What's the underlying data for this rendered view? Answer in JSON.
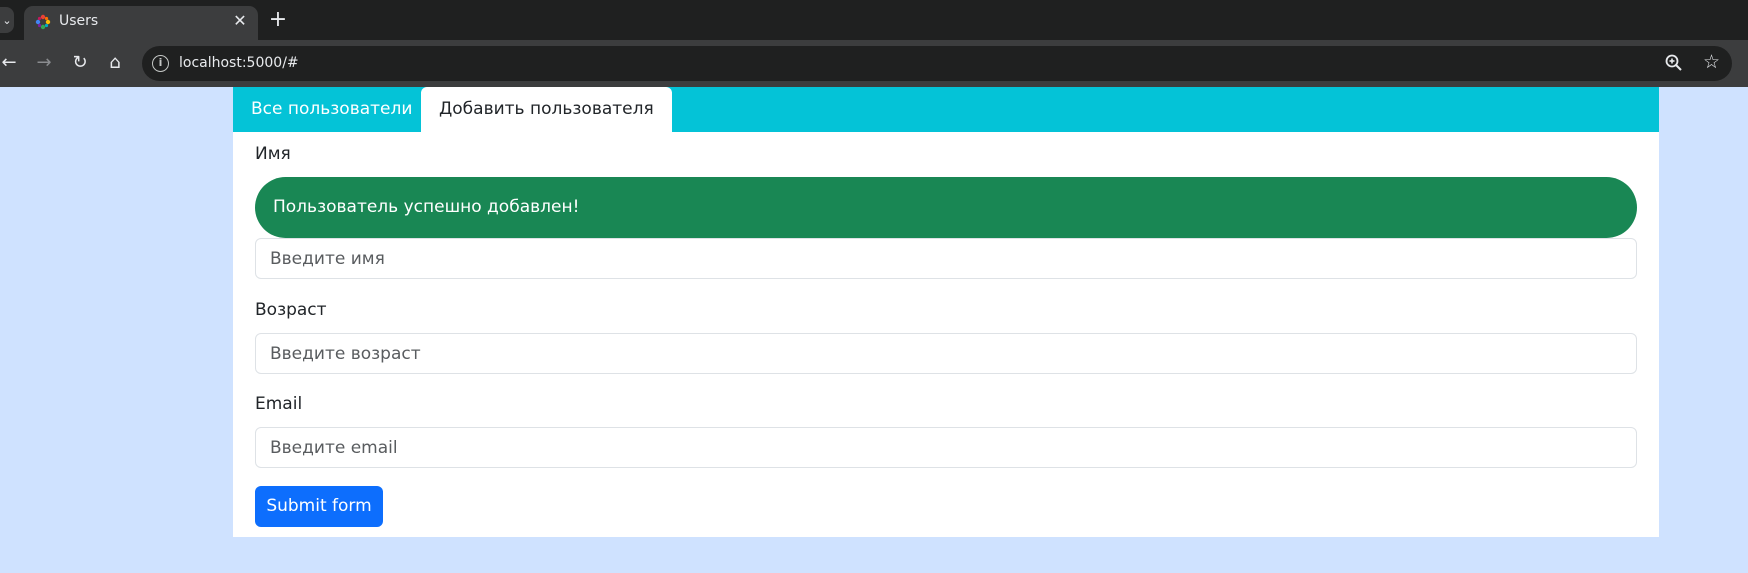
{
  "browser": {
    "tab_title": "Users",
    "close_glyph": "✕",
    "new_tab_glyph": "+",
    "tab_list_glyph": "⌄",
    "url": "localhost:5000/#",
    "back_glyph": "←",
    "forward_glyph": "→",
    "reload_glyph": "↻",
    "home_glyph": "⌂",
    "info_glyph": "i",
    "star_glyph": "☆",
    "icons": [
      "chevron-down-icon",
      "favicon-icon",
      "close-icon",
      "plus-icon",
      "back-arrow-icon",
      "forward-arrow-icon",
      "reload-icon",
      "home-icon",
      "site-info-icon",
      "zoom-icon",
      "bookmark-star-icon"
    ]
  },
  "app": {
    "tabs": [
      {
        "label": "Все пользователи",
        "active": false
      },
      {
        "label": "Добавить пользователя",
        "active": true
      }
    ],
    "form": {
      "name_label": "Имя",
      "alert_text": "Пользователь успешно добавлен!",
      "name_placeholder": "Введите имя",
      "age_label": "Возраст",
      "age_placeholder": "Введите возраст",
      "email_label": "Email",
      "email_placeholder": "Введите email",
      "submit_label": "Submit form"
    }
  },
  "colors": {
    "page_background": "#cfe2ff",
    "tabbar": "#04c3d7",
    "alert_success": "#198754",
    "primary_button": "#0d6efd"
  }
}
